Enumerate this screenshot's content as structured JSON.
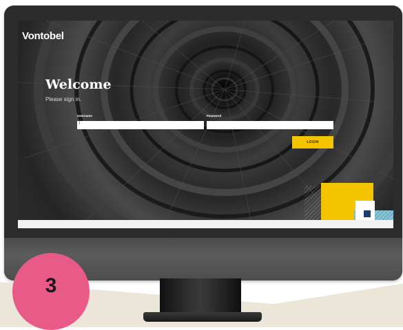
{
  "brand": {
    "logo_text": "Vontobel"
  },
  "login": {
    "title": "Welcome",
    "subtitle": "Please sign in.",
    "username_label": "Username",
    "username_value": "|",
    "password_label": "Password",
    "password_value": "",
    "login_label": "LOGIN"
  },
  "colors": {
    "accent_yellow": "#f5c400",
    "accent_teal": "#8ec6d8",
    "accent_navy": "#1f3e6e",
    "badge_pink": "#e85a87"
  },
  "step": {
    "number": "3"
  }
}
